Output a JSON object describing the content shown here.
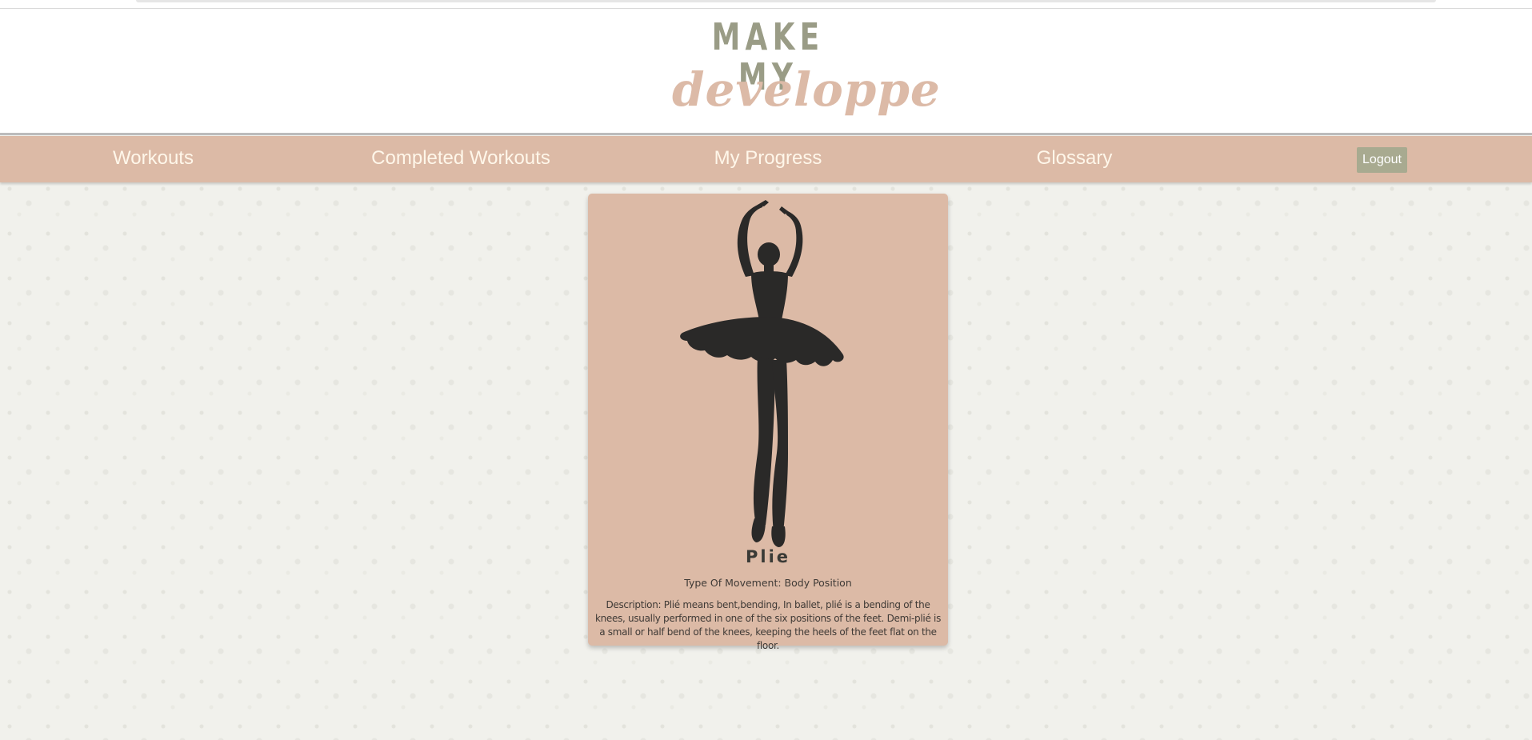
{
  "logo": {
    "line1": "MAKE MY",
    "line2": "developpe"
  },
  "nav": {
    "items": [
      {
        "label": "Workouts"
      },
      {
        "label": "Completed Workouts"
      },
      {
        "label": "My Progress"
      },
      {
        "label": "Glossary"
      }
    ],
    "logout_label": "Logout"
  },
  "card": {
    "image_icon": "ballerina-silhouette",
    "title": "Plie",
    "type": "Type Of Movement: Body Position",
    "description": "Description: Plié means bent,bending, In ballet, plié is a bending of the knees, usually performed in one of the six positions of the feet. Demi-plié is a small or half bend of the knees, keeping the heels of the feet flat on the floor."
  },
  "colors": {
    "accent": "#dcbaa6",
    "logo_green": "#9a9c86",
    "logo_pink": "#dcbaa7",
    "nav_text": "#fff7ea",
    "button": "#a8aa90",
    "silhouette": "#2a2928"
  }
}
